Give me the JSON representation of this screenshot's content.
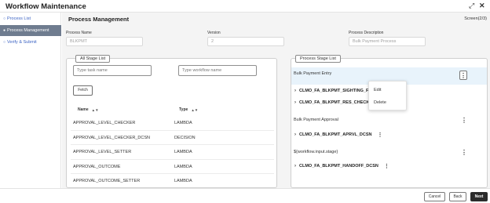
{
  "app": {
    "title": "Workflow Maintenance",
    "expand_icon": "⤢",
    "close_icon": "✕"
  },
  "sidebar": {
    "items": [
      {
        "label": "Process List",
        "icon": "○",
        "active": false
      },
      {
        "label": "Process Management",
        "icon": "●",
        "active": true
      },
      {
        "label": "Verify & Submit",
        "icon": "○",
        "active": false
      }
    ]
  },
  "main": {
    "title": "Process Management",
    "screen_indicator": "Screen(2/3)"
  },
  "fields": {
    "process_name": {
      "label": "Process Name",
      "value": "BLKPMT"
    },
    "version": {
      "label": "Version",
      "value": "2"
    },
    "process_description": {
      "label": "Process Description",
      "value": "Bulk Payment Process"
    }
  },
  "all_stage_list": {
    "legend": "All Stage List",
    "task_placeholder": "Type task name",
    "workflow_placeholder": "Type workflow name",
    "fetch_label": "Fetch",
    "columns": {
      "name": "Name",
      "type": "Type"
    },
    "sort_icon": "▲▼",
    "rows": [
      {
        "name": "APPROVAL_LEVEL_CHECKER",
        "type": "LAMBDA"
      },
      {
        "name": "APPROVAL_LEVEL_CHECKER_DCSN",
        "type": "DECISION"
      },
      {
        "name": "APPROVAL_LEVEL_SETTER",
        "type": "LAMBDA"
      },
      {
        "name": "APPROVAL_OUTCOME",
        "type": "LAMBDA"
      },
      {
        "name": "APPROVAL_OUTCOME_SETTER",
        "type": "LAMBDA"
      }
    ]
  },
  "process_stage_list": {
    "legend": "Process Stage List",
    "menu_icon": "⋮",
    "chevron_icon": "›",
    "stages": [
      {
        "title": "Bulk Payment Entry",
        "steps": [
          "CLMO_FA_BLKPMT_SIGHTING_FUNDS_DCSN",
          "CLMO_FA_BLKPMT_RES_CHECK"
        ]
      },
      {
        "title": "Bulk Payment Approval",
        "steps": [
          "CLMO_FA_BLKPMT_APRVL_DCSN"
        ]
      },
      {
        "title": "${workflow.input.stage}",
        "steps": [
          "CLMO_FA_BLKPMT_HANDOFF_DCSN"
        ]
      }
    ]
  },
  "context_menu": {
    "items": [
      "Edit",
      "Delete"
    ]
  },
  "footer": {
    "cancel": "Cancel",
    "back": "Back",
    "next": "Next"
  }
}
